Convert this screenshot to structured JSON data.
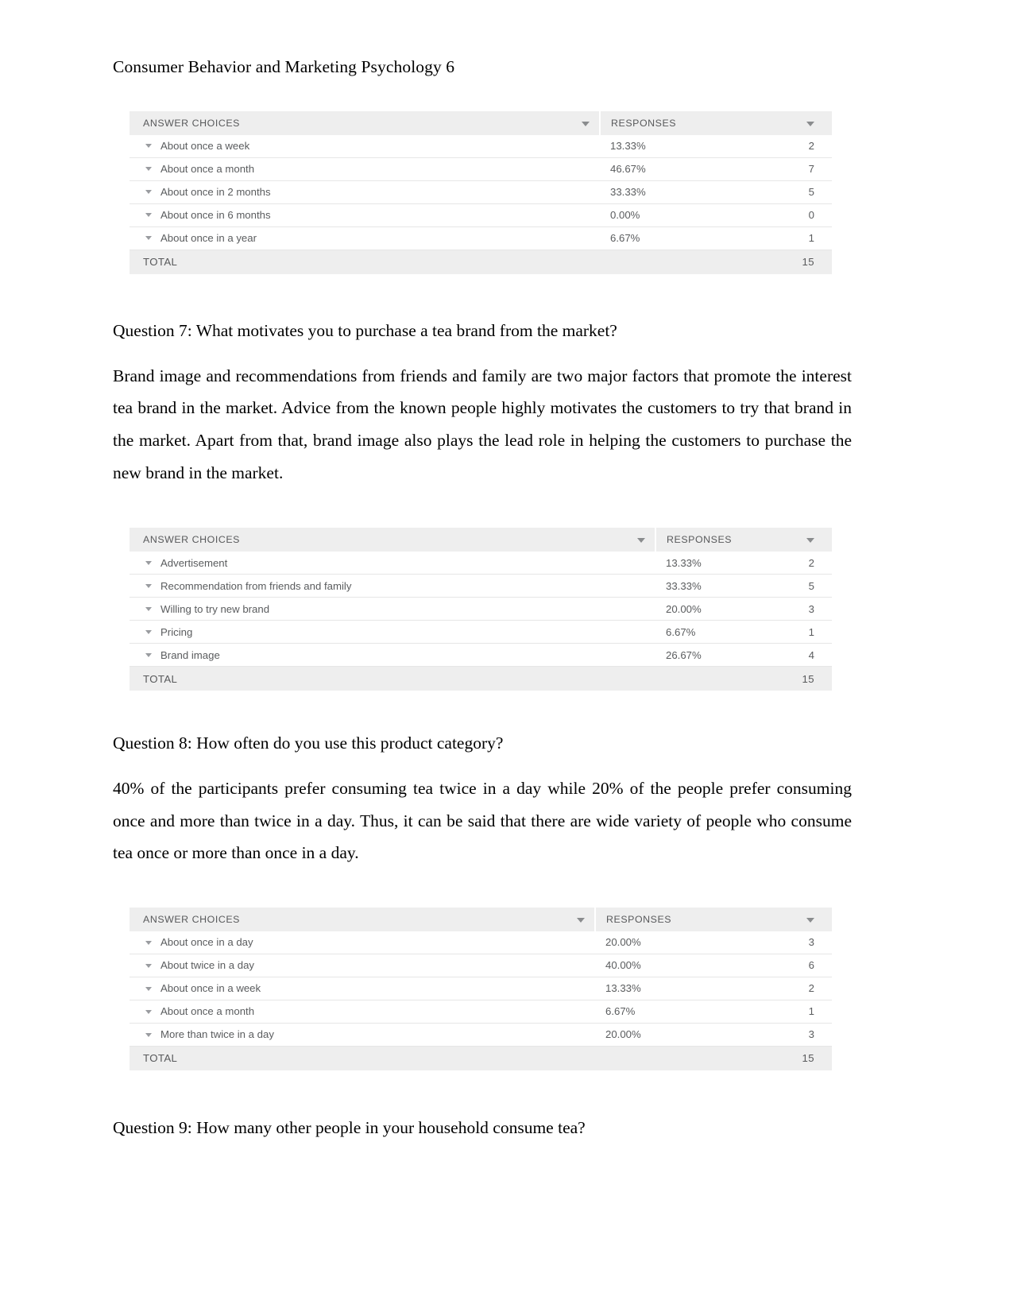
{
  "document": {
    "running_header": "Consumer Behavior and Marketing Psychology 6"
  },
  "table_columns": {
    "answer_choices": "ANSWER CHOICES",
    "responses": "RESPONSES",
    "total": "TOTAL"
  },
  "sections": {
    "q7": {
      "heading": "Question 7: What motivates you to purchase a tea brand from the market?",
      "paragraph": "Brand image and recommendations from friends and family are two major factors that promote the interest tea brand in the market. Advice from the known people highly motivates the customers to try that brand in the market. Apart from that, brand image also plays the lead role in helping the customers to purchase the new brand in the market."
    },
    "q8": {
      "heading": "Question 8: How often do you use this product category?",
      "paragraph": "40% of the participants prefer consuming tea twice in a day while 20% of the people prefer consuming once and more than twice in a day. Thus, it can be said that there are wide variety of people who consume tea once or more than once in a day."
    },
    "q9": {
      "heading": "Question 9: How many other people in your household consume tea?"
    }
  },
  "chart_data": [
    {
      "type": "table",
      "title": "",
      "id": "table-1-purchase-frequency",
      "columns": [
        "ANSWER CHOICES",
        "RESPONSES",
        ""
      ],
      "categories": [
        "About once a week",
        "About once a month",
        "About once in 2 months",
        "About once in 6 months",
        "About once in a year"
      ],
      "percentages": [
        "13.33%",
        "46.67%",
        "33.33%",
        "0.00%",
        "6.67%"
      ],
      "values": [
        2,
        7,
        5,
        0,
        1
      ],
      "total_label": "TOTAL",
      "total_value": 15
    },
    {
      "type": "table",
      "title": "",
      "id": "table-2-purchase-motivation",
      "columns": [
        "ANSWER CHOICES",
        "RESPONSES",
        ""
      ],
      "categories": [
        "Advertisement",
        "Recommendation from friends and family",
        "Willing to try new brand",
        "Pricing",
        "Brand image"
      ],
      "percentages": [
        "13.33%",
        "33.33%",
        "20.00%",
        "6.67%",
        "26.67%"
      ],
      "values": [
        2,
        5,
        3,
        1,
        4
      ],
      "total_label": "TOTAL",
      "total_value": 15
    },
    {
      "type": "table",
      "title": "",
      "id": "table-3-usage-frequency",
      "columns": [
        "ANSWER CHOICES",
        "RESPONSES",
        ""
      ],
      "categories": [
        "About once in a day",
        "About twice in a day",
        "About once in a week",
        "About once a month",
        "More than twice in a day"
      ],
      "percentages": [
        "20.00%",
        "40.00%",
        "13.33%",
        "6.67%",
        "20.00%"
      ],
      "values": [
        3,
        6,
        2,
        1,
        3
      ],
      "total_label": "TOTAL",
      "total_value": 15
    }
  ],
  "icons": {
    "column_sort": "chevron-down-icon",
    "row_expand": "chevron-down-icon"
  },
  "colors": {
    "header_band": "#eeeeee",
    "row_text": "#5a5c5e",
    "header_text": "#58595b",
    "row_divider": "#e6e6e6",
    "page_text": "#000000"
  }
}
